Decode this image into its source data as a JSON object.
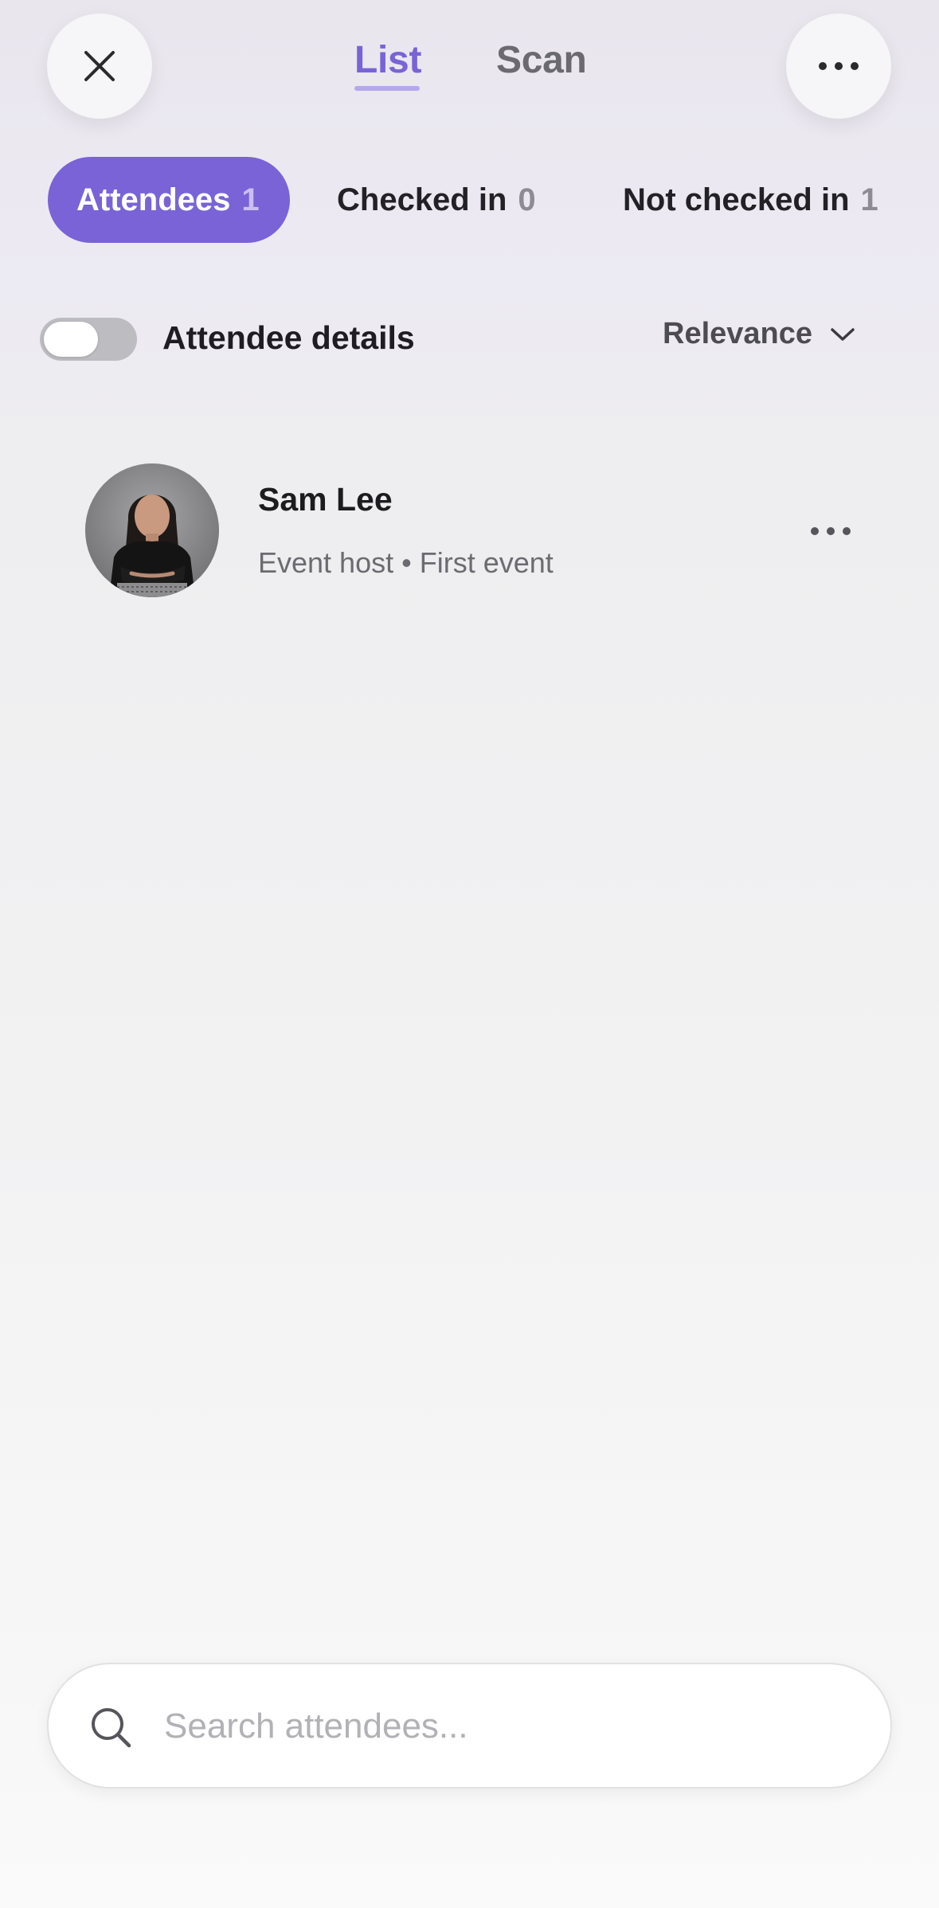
{
  "header": {
    "close_icon": "close-icon",
    "more_icon": "more-horizontal-icon",
    "tabs": [
      {
        "label": "List",
        "active": true
      },
      {
        "label": "Scan",
        "active": false
      }
    ],
    "accent_color": "#7a63d6"
  },
  "filters": [
    {
      "label": "Attendees",
      "count": "1",
      "active": true
    },
    {
      "label": "Checked in",
      "count": "0",
      "active": false
    },
    {
      "label": "Not checked in",
      "count": "1",
      "active": false
    }
  ],
  "options": {
    "attendee_details_label": "Attendee details",
    "attendee_details_enabled": false,
    "sort_label": "Relevance",
    "sort_icon": "chevron-down-icon"
  },
  "attendees": [
    {
      "name": "Sam Lee",
      "meta": "Event host • First event",
      "avatar_icon": "avatar"
    }
  ],
  "search": {
    "placeholder": "Search attendees...",
    "value": "",
    "icon": "search-icon"
  }
}
